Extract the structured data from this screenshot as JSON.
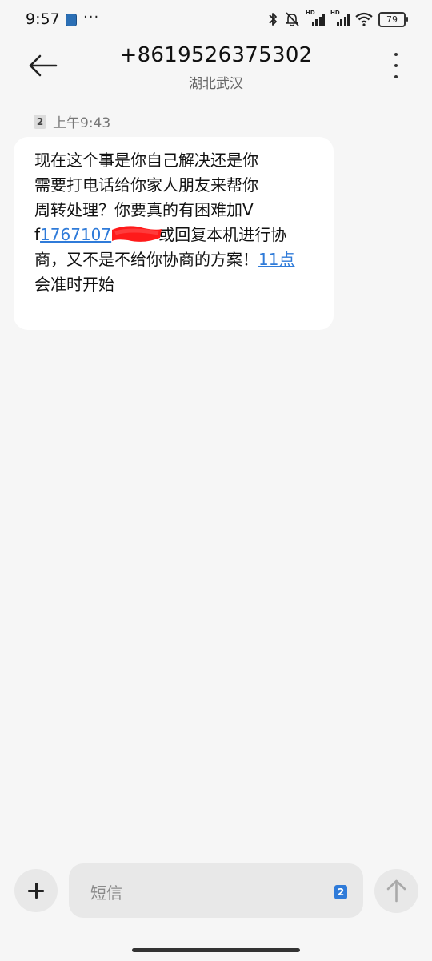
{
  "status_bar": {
    "time": "9:57",
    "more": "···",
    "sim1_label": "HD",
    "sim2_label": "HD",
    "battery": "79"
  },
  "header": {
    "title": "+8619526375302",
    "subtitle": "湖北武汉"
  },
  "message": {
    "sim_badge": "2",
    "time": "上午9:43",
    "lines": [
      "现在这个事是你自己解决还是你",
      "需要打电话给你家人朋友来帮你",
      "周转处理？你要真的有困难加V"
    ],
    "line4_prefix": "f",
    "line4_link_visible": "1767107",
    "line4_suffix": "或回复本机进行协",
    "line5_text": "商，又不是不给你协商的方案！",
    "line5_link": "11点",
    "line6": "会准时开始"
  },
  "composer": {
    "placeholder": "短信",
    "sim_badge": "2"
  },
  "colors": {
    "background": "#f6f6f6",
    "bubble": "#ffffff",
    "link": "#2f7bd9",
    "redaction": "#ff1a1a"
  }
}
